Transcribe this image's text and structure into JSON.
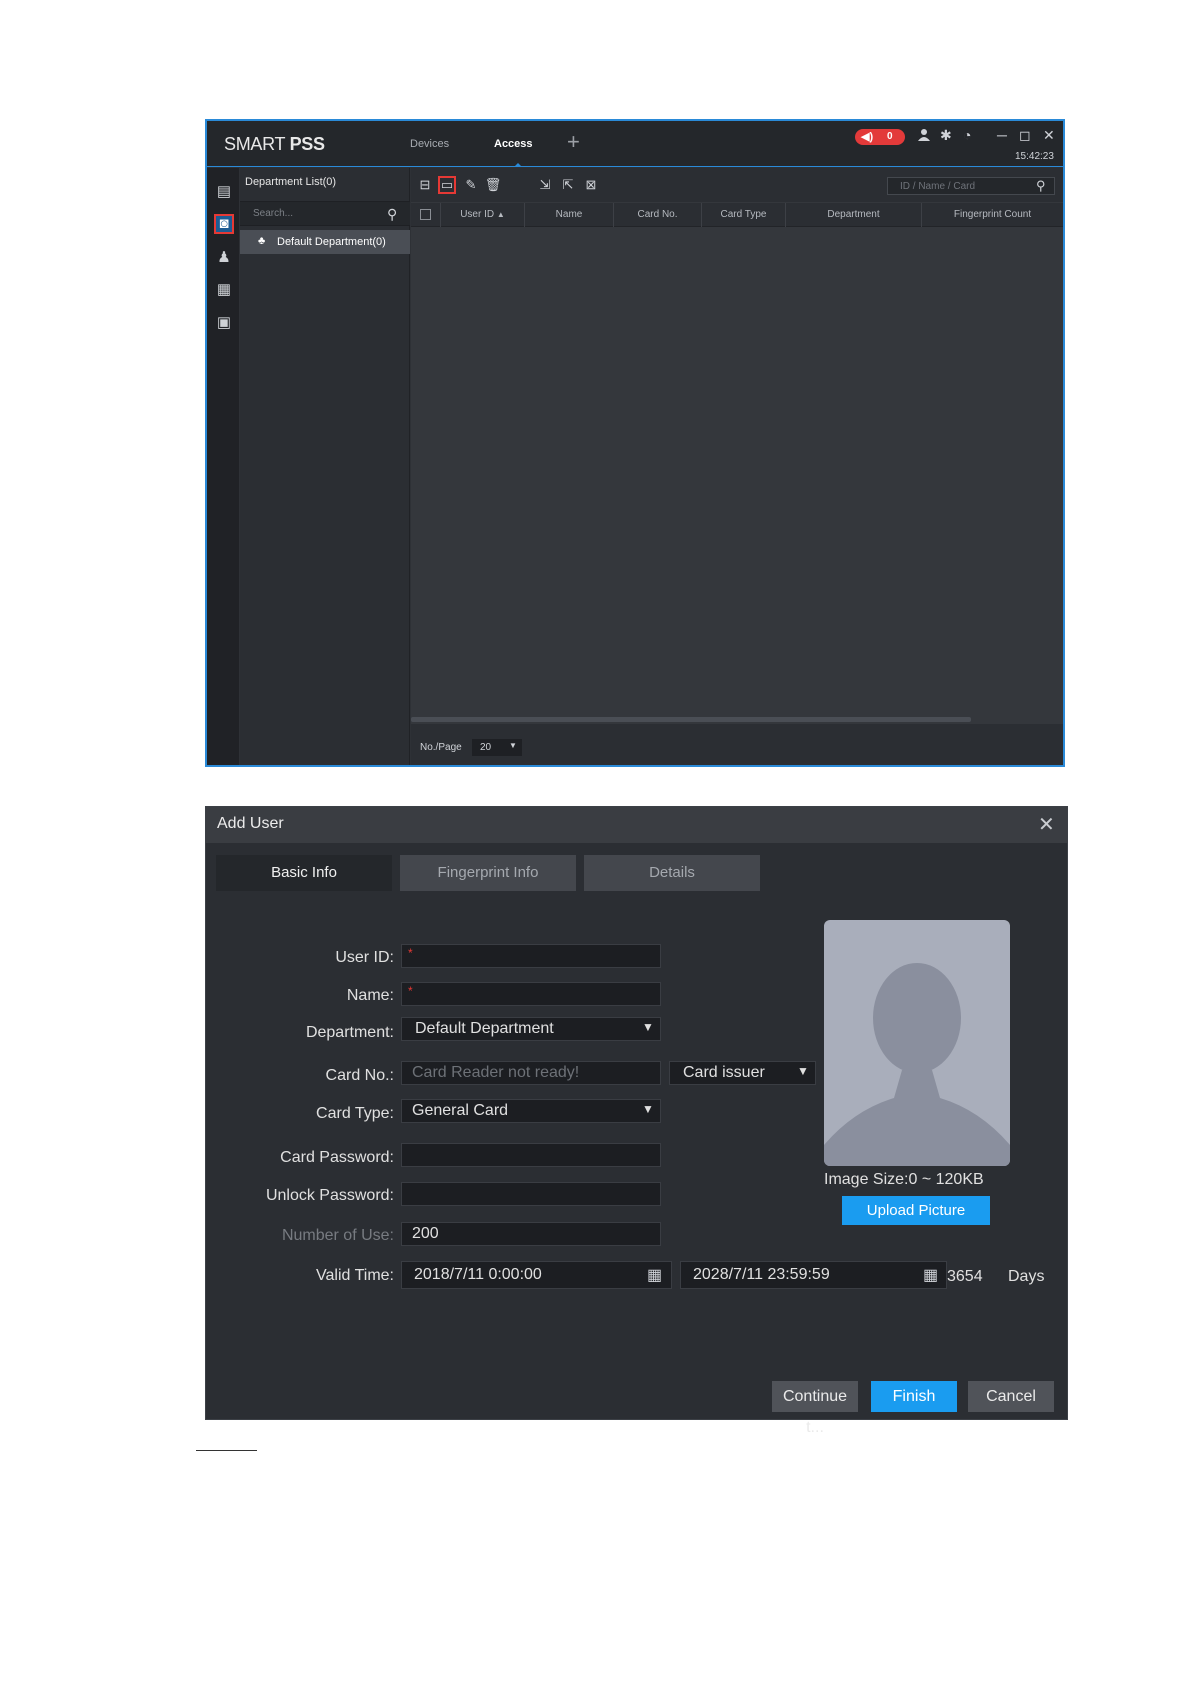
{
  "main_window": {
    "app_title_prefix": "SMART ",
    "app_title_bold": "PSS",
    "tabs": [
      {
        "label": "Devices",
        "active": false
      },
      {
        "label": "Access",
        "active": true
      }
    ],
    "add_tab_glyph": "+",
    "alarm_count": "0",
    "clock": "15:42:23",
    "department_panel": {
      "title": "Department List(0)",
      "search_placeholder": "Search...",
      "items": [
        {
          "label": "Default Department(0)",
          "selected": true
        }
      ]
    },
    "search_placeholder": "ID / Name / Card",
    "table": {
      "columns": [
        "User ID",
        "Name",
        "Card No.",
        "Card Type",
        "Department",
        "Fingerprint Count"
      ],
      "sort_glyph": "▲",
      "rows": []
    },
    "pager": {
      "label": "No./Page",
      "value": "20"
    },
    "icons": {
      "nav": [
        "device-config-icon",
        "user-icon",
        "visitor-icon",
        "record-icon",
        "calendar-icon"
      ],
      "toolbar": [
        "add-user-icon",
        "add-card-icon",
        "edit-icon",
        "delete-icon",
        "import-icon",
        "export-icon",
        "card-issue-icon"
      ]
    },
    "accent_color": "#2a8ad8",
    "highlight_color": "#e53935"
  },
  "add_user_dialog": {
    "title": "Add User",
    "tabs": [
      {
        "label": "Basic Info",
        "active": true
      },
      {
        "label": "Fingerprint Info",
        "active": false
      },
      {
        "label": "Details",
        "active": false
      }
    ],
    "fields": {
      "user_id": {
        "label": "User ID:",
        "value": "",
        "required": true
      },
      "name": {
        "label": "Name:",
        "value": "",
        "required": true
      },
      "department": {
        "label": "Department:",
        "value": "Default Department"
      },
      "card_no": {
        "label": "Card No.:",
        "placeholder": "Card Reader not ready!"
      },
      "card_issuer": {
        "value": "Card issuer"
      },
      "card_type": {
        "label": "Card Type:",
        "value": "General Card"
      },
      "card_password": {
        "label": "Card Password:",
        "value": ""
      },
      "unlock_password": {
        "label": "Unlock Password:",
        "value": ""
      },
      "number_of_use": {
        "label": "Number of Use:",
        "value": "200",
        "disabled": true
      },
      "valid_time": {
        "label": "Valid Time:",
        "start": "2018/7/11 0:00:00",
        "end": "2028/7/11 23:59:59",
        "days": "3654",
        "days_unit": "Days"
      }
    },
    "image_size": "Image Size:0 ~ 120KB",
    "upload_button": "Upload Picture",
    "buttons": {
      "continue": "Continue t...",
      "finish": "Finish",
      "cancel": "Cancel"
    },
    "primary_color": "#1a9cf0"
  }
}
